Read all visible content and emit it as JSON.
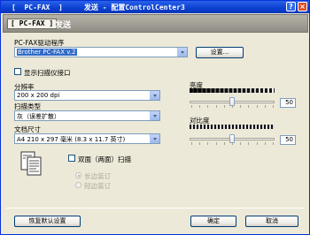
{
  "window": {
    "title": "[  PC-FAX  ]     发送 - 配置ControlCenter3",
    "help": "?",
    "close": "×"
  },
  "header": {
    "tag": "[ PC-FAX ]",
    "title": "发送"
  },
  "driver": {
    "label": "PC-FAX驱动程序",
    "selected": "Brother PC-FAX v.2",
    "settings_button": "设置..."
  },
  "show_scan_ui": {
    "label": "显示扫描仪接口",
    "checked": false
  },
  "resolution": {
    "label": "分辨率",
    "value": "200 x 200 dpi"
  },
  "scan_type": {
    "label": "扫描类型",
    "value": "灰（误差扩散）"
  },
  "doc_size": {
    "label": "文档尺寸",
    "value": "A4 210 x 297 毫米 (8.3 x 11.7 英寸)"
  },
  "duplex": {
    "label": "双面（两面）扫描",
    "checked": false,
    "options": [
      "长边装订",
      "短边装订"
    ]
  },
  "brightness": {
    "label": "亮度",
    "value": "50",
    "level_percent": 50
  },
  "contrast": {
    "label": "对比度",
    "value": "50",
    "level_percent": 50
  },
  "buttons": {
    "restore_defaults": "恢复默认设置",
    "ok": "确定",
    "cancel": "取消"
  },
  "colors": {
    "title_bar": "#0a3fd0",
    "selection": "#316ac5"
  }
}
